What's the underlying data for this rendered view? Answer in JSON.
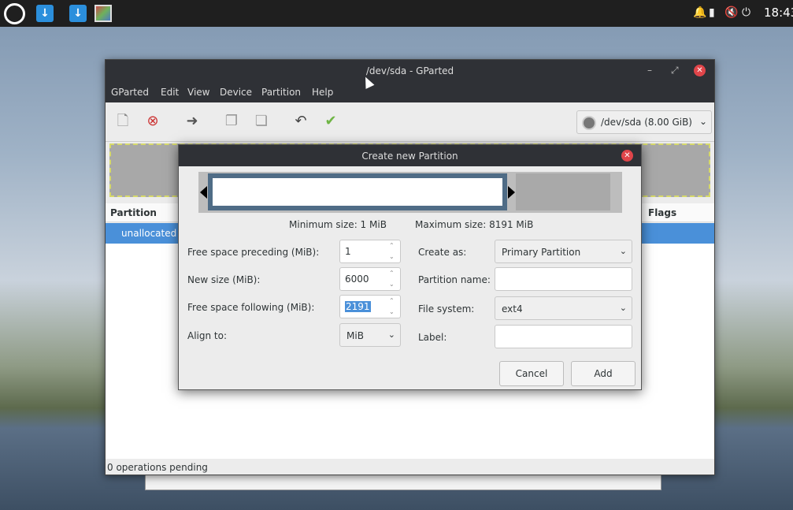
{
  "taskbar": {
    "clock": "18:43",
    "tray_icons": [
      "notification-bell-icon",
      "battery-icon",
      "volume-muted-icon",
      "power-icon"
    ]
  },
  "main_window": {
    "title": "/dev/sda - GParted",
    "menu": [
      "GParted",
      "Edit",
      "View",
      "Device",
      "Partition",
      "Help"
    ],
    "device_selector": "/dev/sda  (8.00 GiB)",
    "columns": {
      "partition": "Partition",
      "flags": "Flags"
    },
    "rows": [
      {
        "name": "unallocated"
      }
    ],
    "status": "0 operations pending"
  },
  "dialog": {
    "title": "Create new Partition",
    "min_size": "Minimum size: 1 MiB",
    "max_size": "Maximum size: 8191 MiB",
    "fields": {
      "free_preceding_label": "Free space preceding (MiB):",
      "free_preceding_value": "1",
      "new_size_label": "New size (MiB):",
      "new_size_value": "6000",
      "free_following_label": "Free space following (MiB):",
      "free_following_value": "2191",
      "align_label": "Align to:",
      "align_value": "MiB",
      "create_as_label": "Create as:",
      "create_as_value": "Primary Partition",
      "partition_name_label": "Partition name:",
      "partition_name_value": "",
      "file_system_label": "File system:",
      "file_system_value": "ext4",
      "label_label": "Label:",
      "label_value": ""
    },
    "buttons": {
      "cancel": "Cancel",
      "add": "Add"
    }
  },
  "colors": {
    "selection": "#4a90d9",
    "titlebar": "#2f3136",
    "close": "#e0454a"
  }
}
